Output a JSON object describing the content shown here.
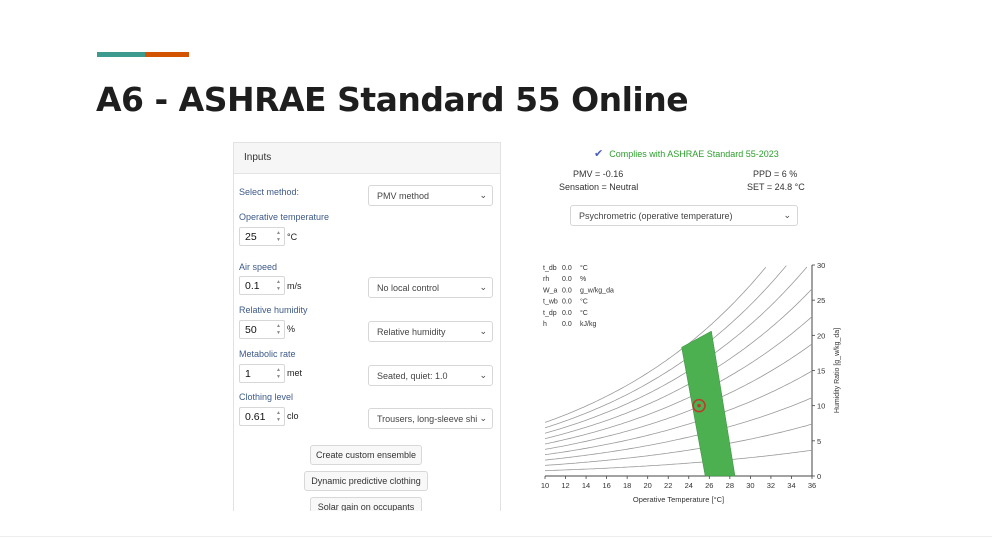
{
  "slide": {
    "title": "A6 - ASHRAE Standard 55 Online",
    "accent_colors": [
      "#3d9a8f",
      "#d35400"
    ]
  },
  "inputs": {
    "header": "Inputs",
    "select_method": {
      "label": "Select method:",
      "value": "PMV method"
    },
    "operative_temperature": {
      "label": "Operative temperature",
      "value": "25",
      "unit": "°C"
    },
    "air_speed": {
      "label": "Air speed",
      "value": "0.1",
      "unit": "m/s",
      "control": "No local control"
    },
    "relative_humidity": {
      "label": "Relative humidity",
      "value": "50",
      "unit": "%",
      "mode": "Relative humidity"
    },
    "metabolic_rate": {
      "label": "Metabolic rate",
      "value": "1",
      "unit": "met",
      "activity": "Seated, quiet: 1.0"
    },
    "clothing_level": {
      "label": "Clothing level",
      "value": "0.61",
      "unit": "clo",
      "ensemble": "Trousers, long-sleeve shi"
    },
    "buttons": {
      "custom_ensemble": "Create custom ensemble",
      "dynamic_clothing": "Dynamic predictive clothing",
      "solar_gain": "Solar gain on occupants"
    }
  },
  "results": {
    "compliance": "Complies with ASHRAE Standard 55-2023",
    "compliance_color": "#2e9e2e",
    "pmv": "PMV = -0.16",
    "sensation": "Sensation = Neutral",
    "ppd": "PPD = 6 %",
    "set": "SET = 24.8 °C",
    "chart_selector": "Psychrometric (operative temperature)"
  },
  "readout": {
    "labels": [
      "t_db",
      "rh",
      "W_a",
      "t_wb",
      "t_dp",
      "h"
    ],
    "values": [
      "0.0",
      "0.0",
      "0.0",
      "0.0",
      "0.0",
      "0.0"
    ],
    "units": [
      "°C",
      "%",
      "g_w/kg_da",
      "°C",
      "°C",
      "kJ/kg"
    ]
  },
  "chart_data": {
    "type": "line",
    "title": "",
    "xlabel": "Operative Temperature [°C]",
    "ylabel": "Humidity Ratio [g_w/kg_da]",
    "xlim": [
      10,
      36
    ],
    "ylim": [
      0,
      30
    ],
    "x_ticks": [
      10,
      12,
      14,
      16,
      18,
      20,
      22,
      24,
      26,
      28,
      30,
      32,
      34,
      36
    ],
    "y_ticks": [
      0,
      5,
      10,
      15,
      20,
      25,
      30
    ],
    "rh_curves_percent": [
      10,
      20,
      30,
      40,
      50,
      60,
      70,
      80,
      90,
      100
    ],
    "comfort_zone": {
      "color": "#4caf50",
      "polygon": [
        [
          23.3,
          18.3
        ],
        [
          26.2,
          20.6
        ],
        [
          28.5,
          0
        ],
        [
          25.6,
          0
        ]
      ]
    },
    "current_point": {
      "x": 25,
      "y": 10
    }
  }
}
